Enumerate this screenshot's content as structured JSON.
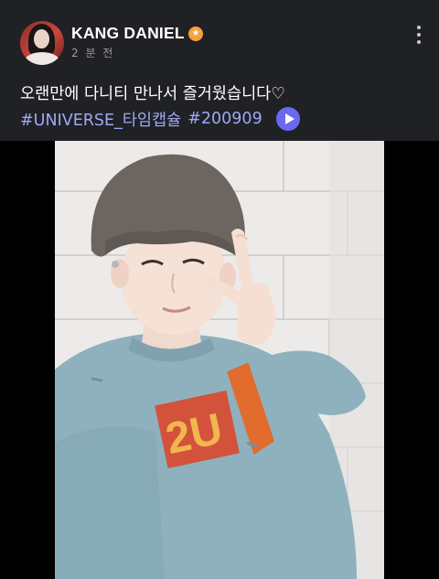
{
  "post": {
    "username": "KANG DANIEL",
    "badge_icon": "star-badge-icon",
    "time": "2 분 전",
    "caption": "오랜만에 다니티 만나서 즐거웠습니다♡",
    "tags": [
      "#UNIVERSE_타임캡슐",
      "#200909"
    ],
    "play_icon": "play-icon",
    "more_icon": "more-vertical-icon",
    "accent_color": "#6a6af0",
    "tag_color": "#9fa8f2"
  }
}
